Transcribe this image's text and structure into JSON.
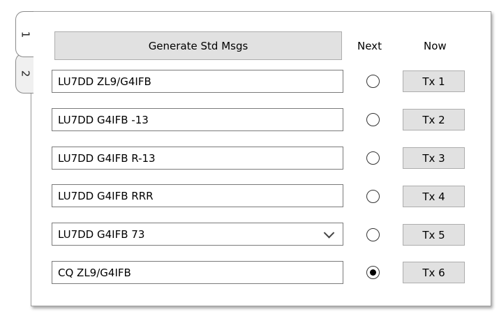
{
  "tabs": [
    {
      "label": "1",
      "selected": true
    },
    {
      "label": "2",
      "selected": false
    }
  ],
  "header": {
    "generate_label": "Generate Std Msgs",
    "next_label": "Next",
    "now_label": "Now"
  },
  "messages": [
    {
      "text": "LU7DD ZL9/G4IFB",
      "tx_label": "Tx 1",
      "next_selected": false,
      "dropdown": false
    },
    {
      "text": "LU7DD G4IFB -13",
      "tx_label": "Tx 2",
      "next_selected": false,
      "dropdown": false
    },
    {
      "text": "LU7DD G4IFB R-13",
      "tx_label": "Tx 3",
      "next_selected": false,
      "dropdown": false
    },
    {
      "text": "LU7DD G4IFB RRR",
      "tx_label": "Tx 4",
      "next_selected": false,
      "dropdown": false
    },
    {
      "text": "LU7DD G4IFB 73",
      "tx_label": "Tx 5",
      "next_selected": false,
      "dropdown": true
    },
    {
      "text": "CQ ZL9/G4IFB",
      "tx_label": "Tx 6",
      "next_selected": true,
      "dropdown": false
    }
  ],
  "icons": {
    "dropdown": "chevron-down-icon"
  }
}
